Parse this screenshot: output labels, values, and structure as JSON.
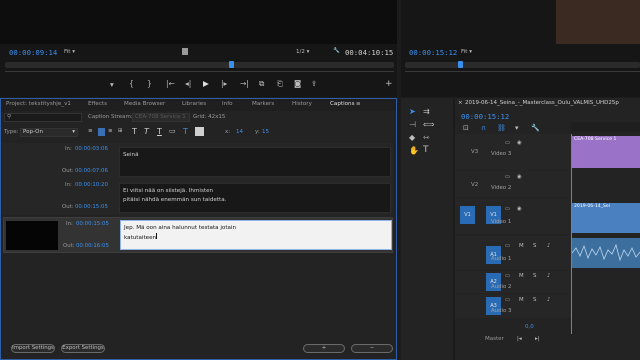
{
  "source_monitor": {
    "timecode": "00:00:09:14",
    "fit": "Fit",
    "fraction": "1/2",
    "duration": "00:04:10:15"
  },
  "program_monitor": {
    "timecode": "00:00:15:12",
    "fit": "Fit"
  },
  "captions_panel": {
    "tabs": [
      "Project: tekstityshje_v1",
      "Effects",
      "Media Browser",
      "Libraries",
      "Info",
      "Markers",
      "History",
      "Captions"
    ],
    "active_tab": "Captions",
    "caption_stream_label": "Caption Stream:",
    "caption_stream_value": "CEA-708 Service 1",
    "grid_label": "Grid: 42x15",
    "type_label": "Type:",
    "type_value": "Pop-On",
    "x_label": "x:",
    "x_value": "14",
    "y_label": "y:",
    "y_value": "15",
    "in_label": "In:",
    "out_label": "Out:",
    "captions": [
      {
        "in": "00:00:03:06",
        "out": "00:00:07:06",
        "line1": "Seinä",
        "line2": ""
      },
      {
        "in": "00:00:10:20",
        "out": "00:00:15:05",
        "line1": "Ei viitsi nää on siistejä. Ihmisten",
        "line2": "pitäisi nähdä enemmän sun taidetta."
      },
      {
        "in": "00:00:15:05",
        "out": "00:00:16:05",
        "line1": "Jep. Mä oon aina halunnut testata jotain",
        "line2": "katutaiteen"
      }
    ],
    "import_label": "Import Settings",
    "export_label": "Export Settings",
    "add_label": "+",
    "remove_label": "−"
  },
  "timeline": {
    "sequence_name": "2019-06-14_Seina_-_Masterclass_Oulu_VALMIS_UHD25p",
    "timecode": "00:00:15:12",
    "tracks": [
      {
        "id": "V3",
        "name": "Video 3"
      },
      {
        "id": "V2",
        "name": "Video 2"
      },
      {
        "id": "V1",
        "name": "Video 1",
        "source": "V1"
      },
      {
        "id": "A1",
        "name": "Audio 1"
      },
      {
        "id": "A2",
        "name": "Audio 2"
      },
      {
        "id": "A3",
        "name": "Audio 3"
      }
    ],
    "master_label": "Master",
    "master_value": "0,0",
    "clip_caption": "CEA-708 Service 1",
    "clip_video": "2019-06-14_Sei",
    "track_btn_m": "M",
    "track_btn_s": "S"
  },
  "colors": {
    "accent": "#3b90ee",
    "caption_clip": "#9a72c8",
    "video_clip": "#4a7fc0",
    "audio_clip": "#3d6f9e"
  }
}
